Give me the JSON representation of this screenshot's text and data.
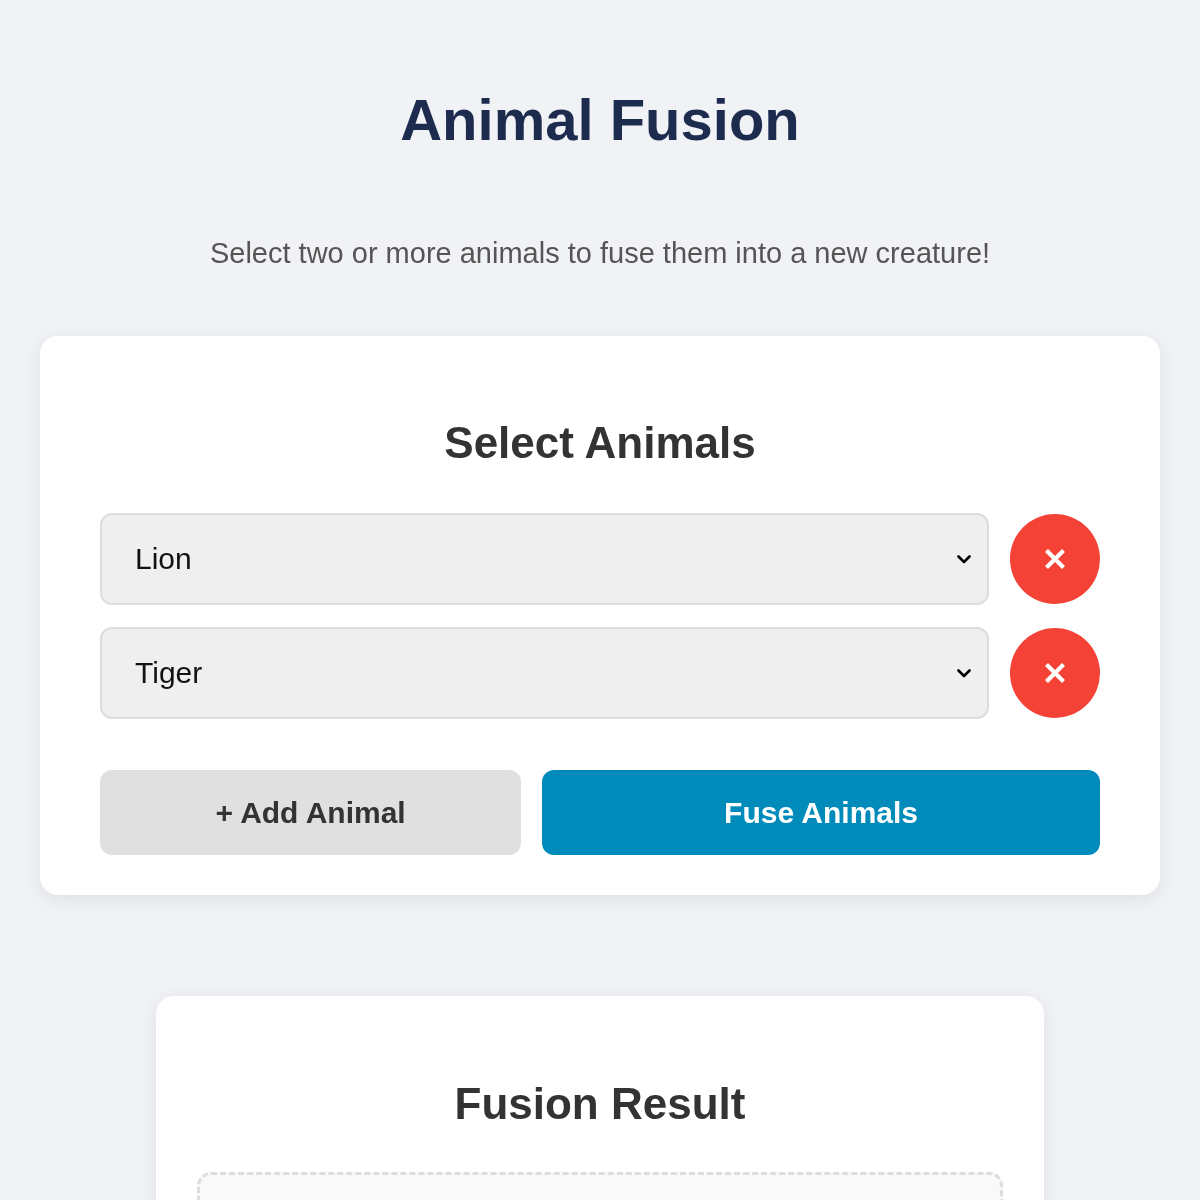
{
  "page": {
    "title": "Animal Fusion",
    "subtitle": "Select two or more animals to fuse them into a new creature!"
  },
  "selection_card": {
    "heading": "Select Animals",
    "animals": [
      {
        "value": "Lion"
      },
      {
        "value": "Tiger"
      }
    ],
    "buttons": [
      {
        "kind": "secondary",
        "label": "+ Add Animal"
      },
      {
        "kind": "primary",
        "label": "Fuse Animals"
      }
    ]
  },
  "result_card": {
    "heading": "Fusion Result"
  }
}
